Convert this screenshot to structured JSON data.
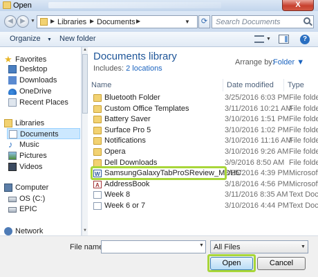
{
  "window": {
    "title": "Open",
    "close_glyph": "X"
  },
  "address": {
    "crumbs": [
      "Libraries",
      "Documents"
    ],
    "search_placeholder": "Search Documents"
  },
  "toolbar": {
    "organize_label": "Organize",
    "new_folder_label": "New folder"
  },
  "nav": {
    "favorites_label": "Favorites",
    "favorites": [
      "Desktop",
      "Downloads",
      "OneDrive",
      "Recent Places"
    ],
    "libraries_label": "Libraries",
    "libraries": [
      "Documents",
      "Music",
      "Pictures",
      "Videos"
    ],
    "computer_label": "Computer",
    "drives": [
      "OS (C:)",
      "EPIC"
    ],
    "network_label": "Network"
  },
  "library": {
    "title": "Documents library",
    "includes_prefix": "Includes:",
    "includes_link": "2 locations",
    "arrange_label": "Arrange by:",
    "arrange_value": "Folder"
  },
  "columns": {
    "name": "Name",
    "date": "Date modified",
    "type": "Type"
  },
  "files": [
    {
      "name": "Bluetooth Folder",
      "date": "3/25/2016 6:03 PM",
      "type": "File folder",
      "icon": "folder-icon"
    },
    {
      "name": "Custom Office Templates",
      "date": "3/11/2016 10:21 AM",
      "type": "File folder",
      "icon": "folder-icon"
    },
    {
      "name": "Battery Saver",
      "date": "3/10/2016 1:51 PM",
      "type": "File folder",
      "icon": "folder-icon"
    },
    {
      "name": "Surface Pro 5",
      "date": "3/10/2016 1:02 PM",
      "type": "File folder",
      "icon": "folder-icon"
    },
    {
      "name": "Notifications",
      "date": "3/10/2016 11:16 AM",
      "type": "File folder",
      "icon": "folder-icon"
    },
    {
      "name": "Opera",
      "date": "3/10/2016 9:26 AM",
      "type": "File folder",
      "icon": "folder-icon"
    },
    {
      "name": "Dell Downloads",
      "date": "3/9/2016 8:50 AM",
      "type": "File folder",
      "icon": "folder-icon"
    },
    {
      "name": "SamsungGalaxyTabProSReview_MDHC",
      "date": "3/25/2016 4:39 PM",
      "type": "Microsoft",
      "icon": "word-doc-icon"
    },
    {
      "name": "AddressBook",
      "date": "3/18/2016 4:56 PM",
      "type": "Microsoft",
      "icon": "access-db-icon"
    },
    {
      "name": "Week 8",
      "date": "3/11/2016 8:35 AM",
      "type": "Text Docu",
      "icon": "text-doc-icon"
    },
    {
      "name": "Week 6 or 7",
      "date": "3/10/2016 4:44 PM",
      "type": "Text Docu",
      "icon": "text-doc-icon"
    }
  ],
  "bottom": {
    "filename_label": "File name:",
    "filename_value": "",
    "filter_value": "All Files",
    "open_label": "Open",
    "cancel_label": "Cancel"
  },
  "colors": {
    "highlight": "#a8d639",
    "link": "#1a63bf",
    "library_title": "#1e5598"
  }
}
